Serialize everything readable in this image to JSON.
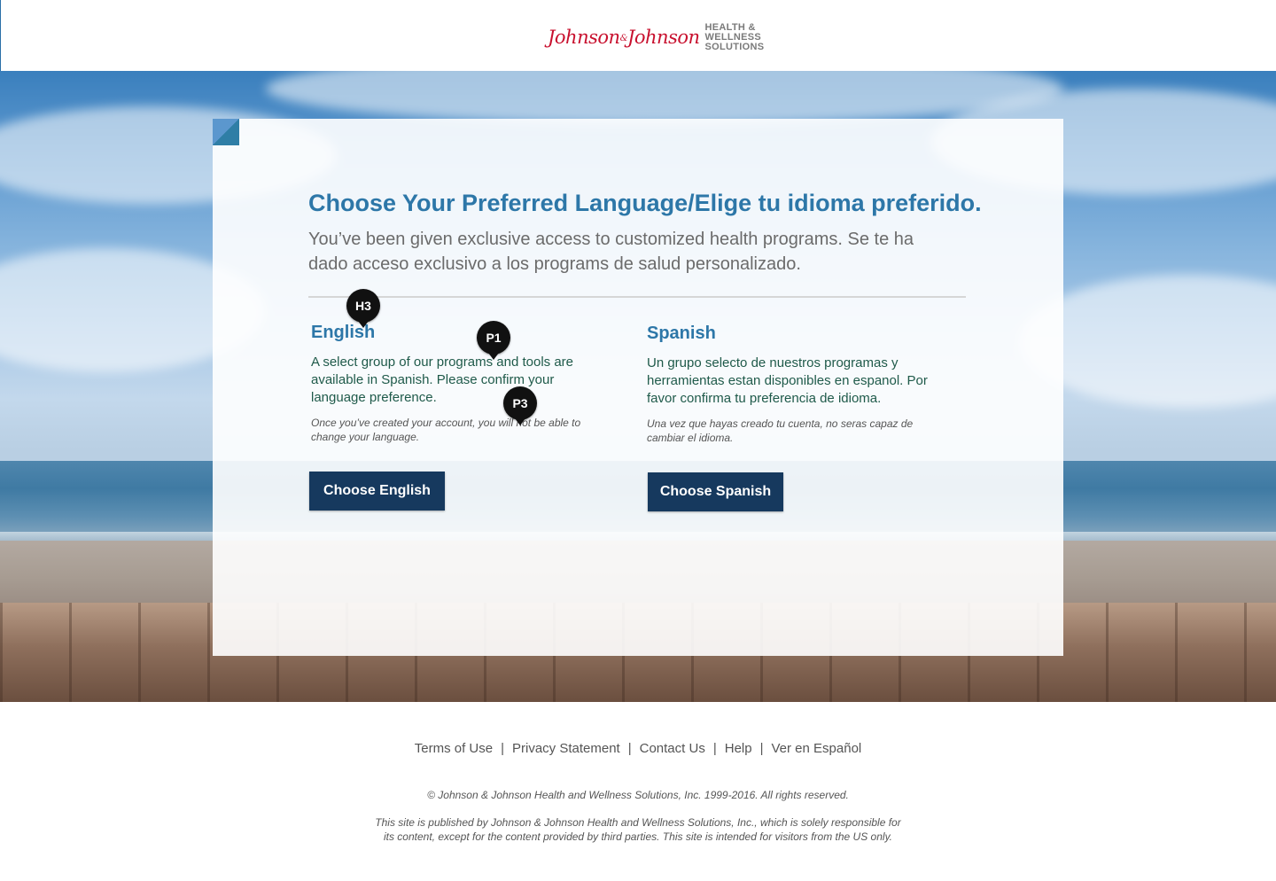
{
  "header": {
    "logo_script": "Johnson",
    "logo_amp": "&",
    "logo_script2": "Johnson",
    "logo_tag_line1": "HEALTH &",
    "logo_tag_line2": "WELLNESS",
    "logo_tag_line3": "SOLUTIONS"
  },
  "main": {
    "title": "Choose Your Preferred Language/Elige tu idioma preferido.",
    "subtitle": "You’ve been given exclusive access to customized health programs. Se te ha dado acceso exclusivo a los programs de salud personalizado.",
    "english": {
      "heading": "English",
      "body": "A select group of our programs and tools are available in Spanish. Please confirm your language preference.",
      "note": "Once you’ve created your account, you will not be able to change your language.",
      "button": "Choose English"
    },
    "spanish": {
      "heading": "Spanish",
      "body": "Un grupo selecto de nuestros programas y herramientas estan disponibles en espanol. Por favor confirma tu preferencia de idioma.",
      "note": "Una vez que hayas creado tu cuenta, no seras capaz de cambiar el idioma.",
      "button": "Choose Spanish"
    }
  },
  "markers": {
    "h3": "H3",
    "p1": "P1",
    "p3": "P3"
  },
  "footer": {
    "links": [
      "Terms of Use",
      "Privacy Statement",
      "Contact Us",
      "Help",
      "Ver en Español"
    ],
    "separator": "|",
    "copyright": "© Johnson & Johnson Health and Wellness Solutions, Inc. 1999-2016. All rights reserved.",
    "disclaimer": "This site is published by Johnson & Johnson Health and Wellness Solutions, Inc., which is solely responsible for its content, except for the content provided by third parties.  This site is intended for visitors from the US only."
  },
  "colors": {
    "brand_red": "#c8102e",
    "heading_blue": "#2d77a8",
    "button_navy": "#16395e",
    "body_green": "#1f5a4a"
  }
}
